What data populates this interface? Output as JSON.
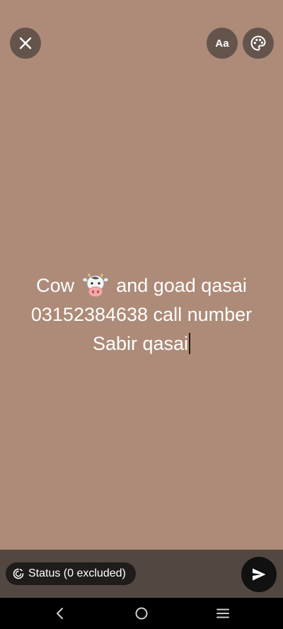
{
  "status_editor": {
    "text_lines": [
      {
        "before": "Cow",
        "emoji": "cow-face",
        "after": "and goad qasai"
      },
      {
        "text": "03152384638 call number"
      },
      {
        "text": "Sabir qasai"
      }
    ],
    "background_color": "#ad8b78",
    "text_color": "#ffffff"
  },
  "toolbar": {
    "close_icon": "close-icon",
    "font_label": "Aa",
    "palette_icon": "palette-icon"
  },
  "bottom": {
    "audience_label": "Status (0 excluded)",
    "audience_icon": "status-ring-icon",
    "send_icon": "send-icon"
  },
  "nav": {
    "back_icon": "back-chevron-icon",
    "home_icon": "home-circle-icon",
    "recents_icon": "recents-lines-icon"
  }
}
